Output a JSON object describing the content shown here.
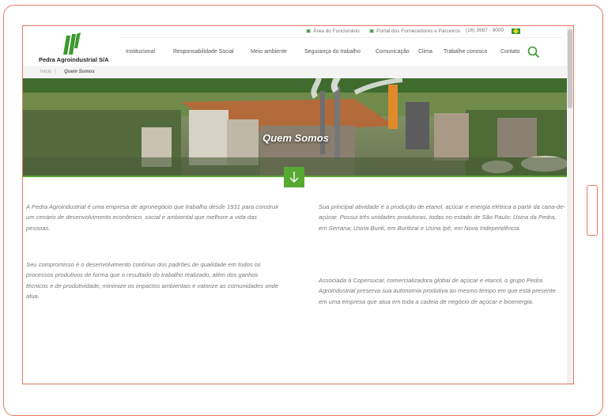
{
  "utility_links": [
    {
      "label": "Área do Funcionário"
    },
    {
      "label": "Portal dos Fornecedores e Parceiros"
    },
    {
      "label": "(16) 3987 - 9000"
    }
  ],
  "brand": {
    "name": "Pedra Agroindustrial S/A",
    "color": "#3c9a2d"
  },
  "nav": {
    "items": [
      {
        "label": "Institucional"
      },
      {
        "label": "Responsabilidade Social"
      },
      {
        "label": "Meio ambiente"
      },
      {
        "label": "Segurança do trabalho"
      },
      {
        "label": "Comunicação"
      },
      {
        "label": "Clima"
      },
      {
        "label": "Trabalhe conosco"
      },
      {
        "label": "Contato"
      }
    ],
    "search_icon": "search-icon"
  },
  "breadcrumb": {
    "home": "Início",
    "separator": "/",
    "current": "Quem Somos"
  },
  "hero": {
    "title": "Quem Somos",
    "arrow_icon": "arrow-down-icon",
    "accent": "#58a834"
  },
  "content": {
    "left": [
      "A Pedra Agroindustrial é uma empresa de agronegócio que trabalha desde 1931 para construir um cenário de desenvolvimento econômico, social e ambiental que melhore a vida das pessoas.",
      "Seu compromisso é o desenvolvimento contínuo dos padrões de qualidade em todos os processos produtivos de forma que o resultado do trabalho realizado, além dos ganhos técnicos e de produtividade, minimize os impactos ambientais e valorize as comunidades onde atua."
    ],
    "right": [
      "Sua principal atividade é a produção de etanol, açúcar e energia elétrica a partir da cana-de-açúcar. Possui três unidades produtoras, todas no estado de São Paulo: Usina da Pedra, em Serrana; Usina Buriti, em Buritizal e Usina Ipê, em Nova Independência.",
      "Associada à Copersucar, comercializadora global de açúcar e etanol, o grupo Pedra Agroindustrial preserva sua autonomia produtiva ao mesmo tempo em que está presente em uma empresa que atua em toda a cadeia de negócio de açúcar e bioenergia."
    ]
  }
}
